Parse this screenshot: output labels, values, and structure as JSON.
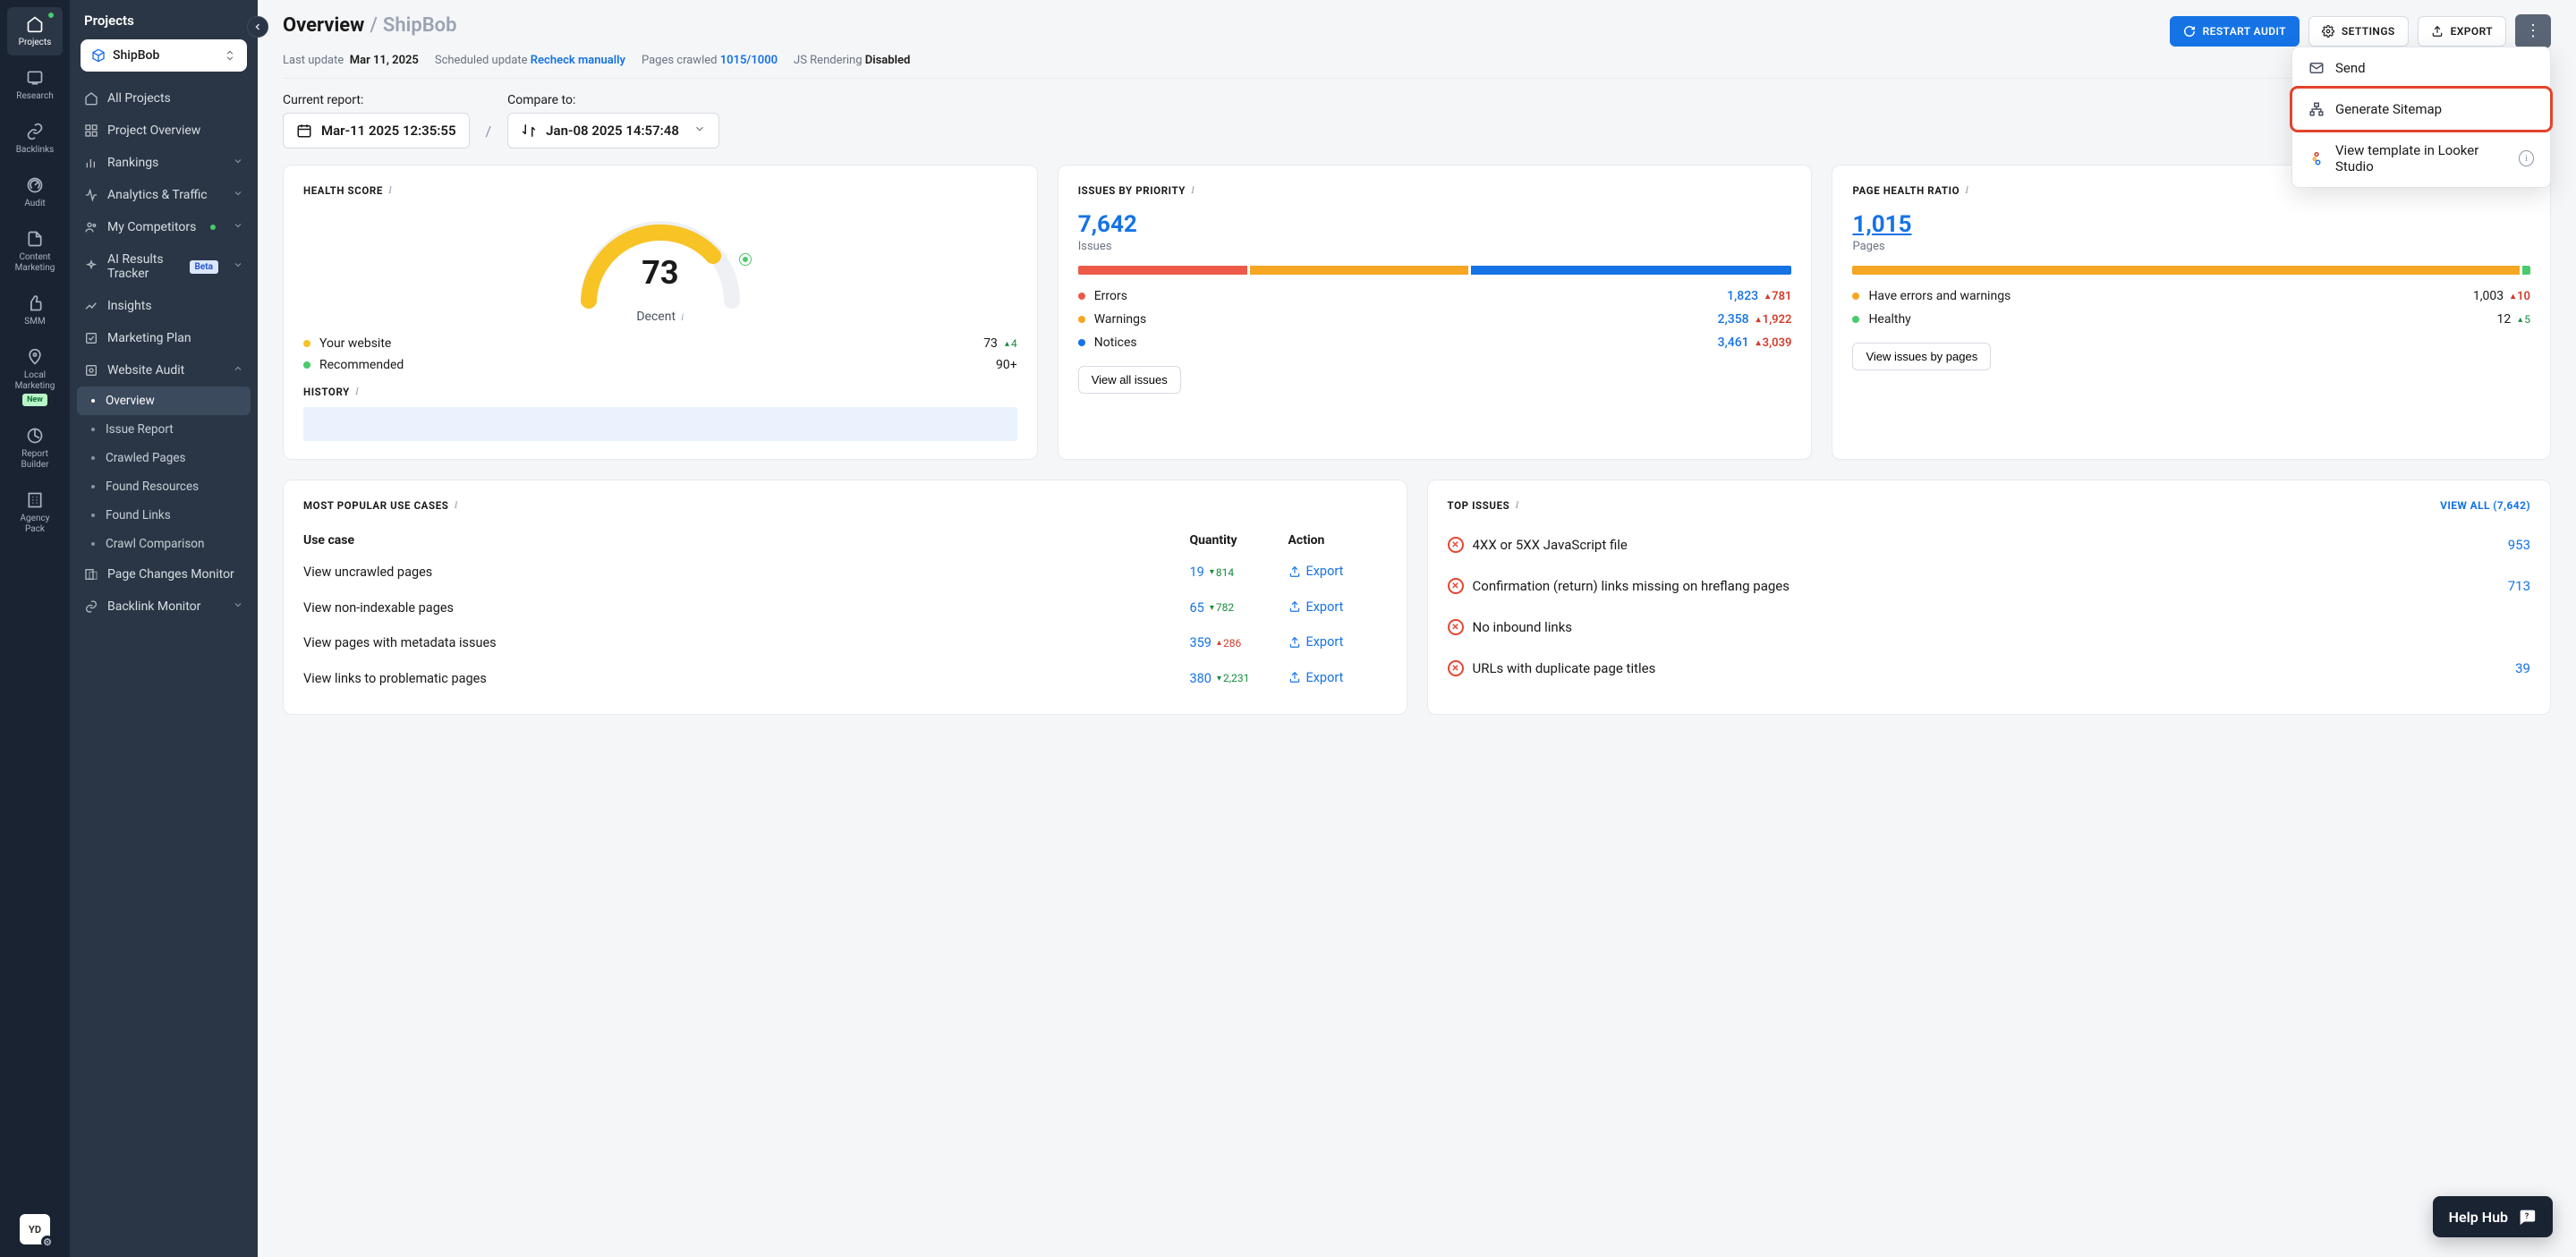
{
  "rail": {
    "items": [
      {
        "label": "Projects",
        "icon": "home"
      },
      {
        "label": "Research",
        "icon": "screen"
      },
      {
        "label": "Backlinks",
        "icon": "link"
      },
      {
        "label": "Audit",
        "icon": "gauge"
      },
      {
        "label": "Content Marketing",
        "icon": "doc"
      },
      {
        "label": "SMM",
        "icon": "thumb"
      },
      {
        "label": "Local Marketing",
        "icon": "pin",
        "badge": "New"
      },
      {
        "label": "Report Builder",
        "icon": "chart"
      },
      {
        "label": "Agency Pack",
        "icon": "building"
      }
    ],
    "avatar": "YD"
  },
  "sidebar": {
    "title": "Projects",
    "project_name": "ShipBob",
    "nav": {
      "all_projects": "All Projects",
      "project_overview": "Project Overview",
      "rankings": "Rankings",
      "analytics": "Analytics & Traffic",
      "competitors": "My Competitors",
      "ai_results": "AI Results Tracker",
      "ai_badge": "Beta",
      "insights": "Insights",
      "marketing_plan": "Marketing Plan",
      "website_audit": "Website Audit",
      "audit_sub": [
        {
          "label": "Overview",
          "active": true
        },
        {
          "label": "Issue Report"
        },
        {
          "label": "Crawled Pages"
        },
        {
          "label": "Found Resources"
        },
        {
          "label": "Found Links"
        },
        {
          "label": "Crawl Comparison"
        }
      ],
      "page_changes": "Page Changes Monitor",
      "backlink_monitor": "Backlink Monitor"
    }
  },
  "header": {
    "crumb_overview": "Overview",
    "crumb_project": "ShipBob",
    "restart_btn": "RESTART AUDIT",
    "settings_btn": "SETTINGS",
    "export_btn": "EXPORT"
  },
  "meta": {
    "last_update_label": "Last update",
    "last_update_value": "Mar 11, 2025",
    "scheduled_label": "Scheduled update",
    "scheduled_value": "Recheck manually",
    "pages_label": "Pages crawled",
    "pages_value": "1015/1000",
    "js_label": "JS Rendering",
    "js_value": "Disabled"
  },
  "reports": {
    "current_label": "Current report:",
    "current_value": "Mar-11 2025 12:35:55",
    "compare_label": "Compare to:",
    "compare_value": "Jan-08 2025 14:57:48"
  },
  "health": {
    "title": "HEALTH SCORE",
    "score": "73",
    "rating": "Decent",
    "your_website_label": "Your website",
    "your_website_value": "73",
    "your_website_delta": "4",
    "recommended_label": "Recommended",
    "recommended_value": "90+",
    "history_title": "HISTORY"
  },
  "issues": {
    "title": "ISSUES BY PRIORITY",
    "total": "7,642",
    "sub": "Issues",
    "rows": [
      {
        "label": "Errors",
        "value": "1,823",
        "delta": "781",
        "color": "#ed5a49"
      },
      {
        "label": "Warnings",
        "value": "2,358",
        "delta": "1,922",
        "color": "#f5a623"
      },
      {
        "label": "Notices",
        "value": "3,461",
        "delta": "3,039",
        "color": "#1573e6"
      }
    ],
    "btn": "View all issues"
  },
  "ratio": {
    "title": "PAGE HEALTH RATIO",
    "total": "1,015",
    "sub": "Pages",
    "rows": [
      {
        "label": "Have errors and warnings",
        "value": "1,003",
        "delta": "10",
        "dir": "up-red",
        "color": "#f5a623"
      },
      {
        "label": "Healthy",
        "value": "12",
        "delta": "5",
        "dir": "up-green",
        "color": "#4ac96d"
      }
    ],
    "btn": "View issues by pages"
  },
  "usecases": {
    "title": "MOST POPULAR USE CASES",
    "col_usecase": "Use case",
    "col_qty": "Quantity",
    "col_action": "Action",
    "export_text": "Export",
    "rows": [
      {
        "label": "View uncrawled pages",
        "value": "19",
        "delta": "814",
        "dir": "down"
      },
      {
        "label": "View non-indexable pages",
        "value": "65",
        "delta": "782",
        "dir": "down"
      },
      {
        "label": "View pages with metadata issues",
        "value": "359",
        "delta": "286",
        "dir": "up"
      },
      {
        "label": "View links to problematic pages",
        "value": "380",
        "delta": "2,231",
        "dir": "down"
      }
    ]
  },
  "topissues": {
    "title": "TOP ISSUES",
    "view_all": "VIEW ALL (7,642)",
    "rows": [
      {
        "label": "4XX or 5XX JavaScript file",
        "value": "953"
      },
      {
        "label": "Confirmation (return) links missing on hreflang pages",
        "value": "713"
      },
      {
        "label": "No inbound links",
        "value": ""
      },
      {
        "label": "URLs with duplicate page titles",
        "value": "39"
      }
    ]
  },
  "export_menu": {
    "send": "Send",
    "generate": "Generate Sitemap",
    "looker": "View template in Looker Studio"
  },
  "help_hub": "Help Hub"
}
